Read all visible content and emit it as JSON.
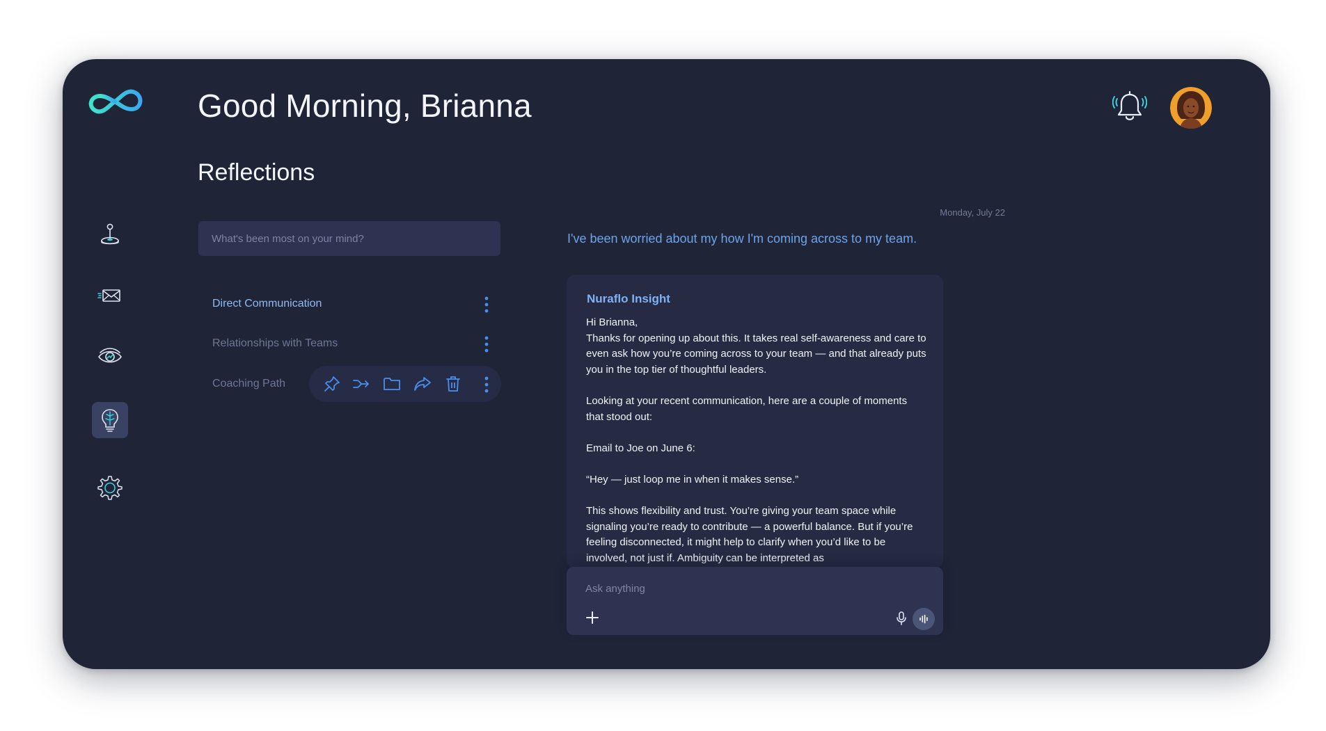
{
  "header": {
    "greeting": "Good Morning, Brianna",
    "logo_icon": "infinity-logo-icon",
    "notification_icon": "bell-icon",
    "avatar_icon": "user-avatar"
  },
  "sidebar": {
    "items": [
      {
        "icon": "joystick-icon",
        "active": false
      },
      {
        "icon": "mail-icon",
        "active": false
      },
      {
        "icon": "eye-chart-icon",
        "active": false
      },
      {
        "icon": "lightbulb-brain-icon",
        "active": true
      },
      {
        "icon": "gear-icon",
        "active": false
      }
    ]
  },
  "reflections": {
    "title": "Reflections",
    "search_placeholder": "What's been most on your mind?",
    "topics": [
      {
        "label": "Direct Communication",
        "selected": true
      },
      {
        "label": "Relationships with Teams",
        "selected": false
      },
      {
        "label": "Coaching Path",
        "selected": false
      }
    ],
    "actions": [
      "pin-icon",
      "merge-icon",
      "folder-icon",
      "share-icon",
      "trash-icon",
      "more-vertical-icon"
    ]
  },
  "conversation": {
    "date": "Monday, July 22",
    "user_message": "I've been worried about my how I'm coming across to my team.",
    "insight_title": "Nuraflo Insight",
    "insight_text": "Hi Brianna,\nThanks for opening up about this. It takes real self-awareness and care to even ask how you’re coming across to your team — and that already puts you in the top tier of thoughtful leaders.\n\nLooking at your recent communication, here are a couple of moments that stood out:\n\nEmail to Joe on June 6:\n\n“Hey — just loop me in when it makes sense.”\n\nThis shows flexibility and trust. You’re giving your team space while signaling you’re ready to contribute — a powerful balance. But if you’re feeling disconnected, it might help to clarify when you’d like to be involved, not just if. Ambiguity can be interpreted as"
  },
  "composer": {
    "placeholder": "Ask anything",
    "add_icon": "plus-icon",
    "mic_icon": "microphone-icon",
    "voice_icon": "voice-wave-icon"
  },
  "colors": {
    "panel_bg": "#1f2437",
    "card_bg": "#262b43",
    "input_bg": "#2d3350",
    "accent_blue": "#4a8ef0",
    "accent_teal": "#3fd0d6",
    "text_primary": "#f3f5fb",
    "text_muted": "#737c98"
  }
}
